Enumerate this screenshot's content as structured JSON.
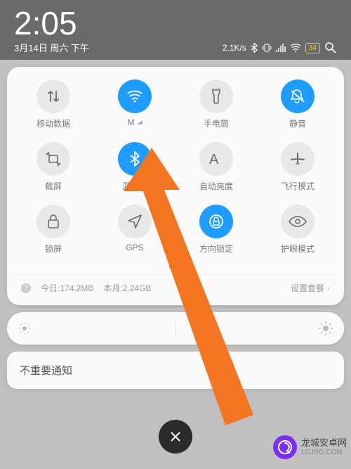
{
  "status": {
    "time": "2:05",
    "date": "3月14日 周六 下午",
    "netspeed": "2.1K/s",
    "battery": "34"
  },
  "tiles": [
    {
      "id": "mobile-data",
      "label": "移动数据",
      "icon": "updown",
      "on": false,
      "signal": false
    },
    {
      "id": "wifi",
      "label": "M",
      "icon": "wifi",
      "on": true,
      "signal": true
    },
    {
      "id": "flashlight",
      "label": "手电筒",
      "icon": "flashlight",
      "on": false,
      "signal": false
    },
    {
      "id": "mute",
      "label": "静音",
      "icon": "mute",
      "on": true,
      "signal": false
    },
    {
      "id": "screenshot",
      "label": "截屏",
      "icon": "screenshot",
      "on": false,
      "signal": false
    },
    {
      "id": "bluetooth",
      "label": "蓝牙",
      "icon": "bluetooth",
      "on": true,
      "signal": true
    },
    {
      "id": "auto-bright",
      "label": "自动亮度",
      "icon": "auto",
      "on": false,
      "signal": false
    },
    {
      "id": "airplane",
      "label": "飞行模式",
      "icon": "airplane",
      "on": false,
      "signal": false
    },
    {
      "id": "lock",
      "label": "锁屏",
      "icon": "lock",
      "on": false,
      "signal": false
    },
    {
      "id": "gps",
      "label": "GPS",
      "icon": "gps",
      "on": false,
      "signal": false
    },
    {
      "id": "rotation",
      "label": "方向锁定",
      "icon": "rotation",
      "on": true,
      "signal": false
    },
    {
      "id": "eye",
      "label": "护眼模式",
      "icon": "eye",
      "on": false,
      "signal": false
    }
  ],
  "data_usage": {
    "today": "今日:174.2MB",
    "month": "本月:2.24GB",
    "plan": "设置套餐"
  },
  "notif": {
    "label": "不重要通知"
  },
  "watermark": {
    "line1": "龙城安卓网",
    "line2": "LCJRG.COM"
  }
}
